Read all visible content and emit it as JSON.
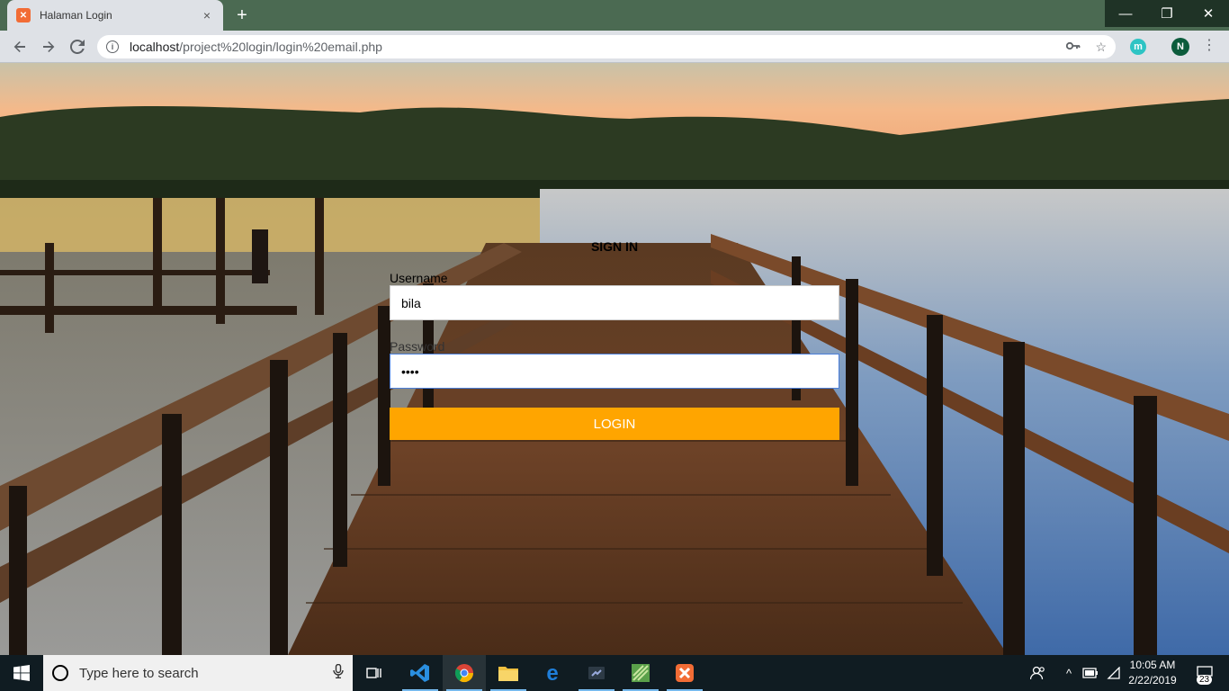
{
  "browser": {
    "tab_title": "Halaman Login",
    "tab_close": "×",
    "new_tab": "+",
    "url_host": "localhost",
    "url_path": "/project%20login/login%20email.php",
    "profile_initial": "N",
    "extension_initial": "m",
    "window_controls": {
      "minimize": "—",
      "restore": "❐",
      "close": "✕"
    }
  },
  "login": {
    "title": "SIGN IN",
    "username_label": "Username",
    "username_value": "bila",
    "password_label": "Password",
    "password_value": "••••",
    "button_label": "LOGIN"
  },
  "taskbar": {
    "search_placeholder": "Type here to search",
    "time": "10:05 AM",
    "date": "2/22/2019",
    "notification_count": "23",
    "apps": [
      "task-view",
      "vscode",
      "chrome",
      "file-explorer",
      "edge",
      "dev-tool",
      "sublime-text",
      "xampp"
    ]
  },
  "colors": {
    "login_button": "#ffa500",
    "titlebar": "#4b6a52",
    "taskbar": "#101c22"
  }
}
